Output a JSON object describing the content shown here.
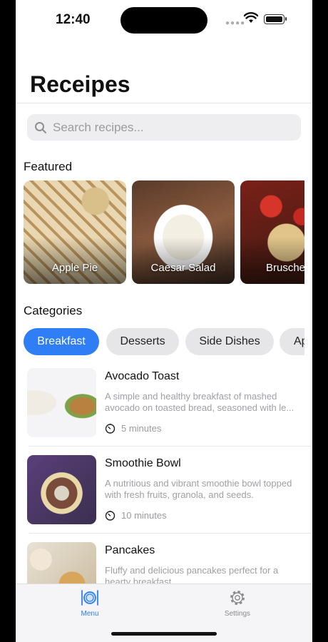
{
  "status_bar": {
    "time": "12:40"
  },
  "header": {
    "title": "Receipes"
  },
  "search": {
    "placeholder": "Search recipes..."
  },
  "featured": {
    "title": "Featured",
    "items": [
      {
        "label": "Apple Pie"
      },
      {
        "label": "Caesar Salad"
      },
      {
        "label": "Brusche"
      }
    ]
  },
  "categories": {
    "title": "Categories",
    "items": [
      {
        "label": "Breakfast",
        "selected": true
      },
      {
        "label": "Desserts",
        "selected": false
      },
      {
        "label": "Side Dishes",
        "selected": false
      },
      {
        "label": "Ap",
        "selected": false
      }
    ]
  },
  "recipes": [
    {
      "name": "Avocado Toast",
      "description": "A simple and healthy breakfast of mashed avocado on toasted bread, seasoned with le...",
      "time": "5 minutes"
    },
    {
      "name": "Smoothie Bowl",
      "description": "A nutritious and vibrant smoothie bowl topped with fresh fruits, granola, and seeds.",
      "time": "10 minutes"
    },
    {
      "name": "Pancakes",
      "description": "Fluffy and delicious pancakes perfect for a hearty breakfast",
      "time": ""
    }
  ],
  "tabbar": {
    "menu": {
      "label": "Menu",
      "icon": "menu-plate-icon",
      "active": true
    },
    "settings": {
      "label": "Settings",
      "icon": "gear-icon",
      "active": false
    }
  },
  "colors": {
    "accent": "#2f7ef5",
    "chip_inactive": "#e6e6e8",
    "secondary_text": "#a0a0a5"
  }
}
